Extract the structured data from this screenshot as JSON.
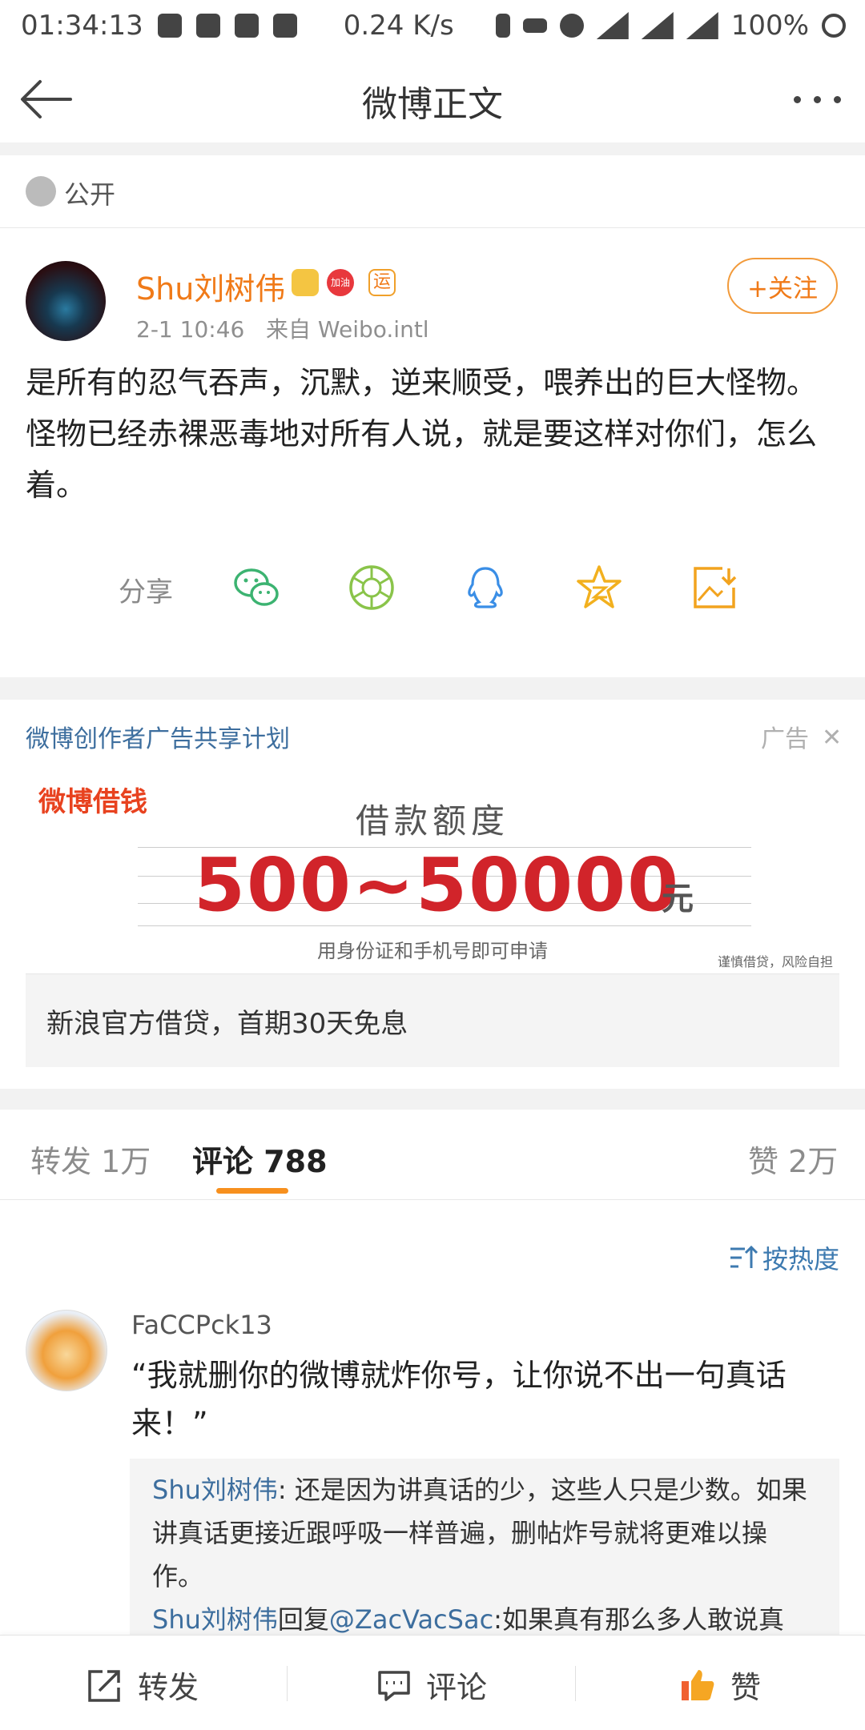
{
  "status": {
    "time": "01:34:13",
    "speed": "0.24 K/s",
    "battery": "100%"
  },
  "header": {
    "title": "微博正文"
  },
  "visibility": "公开",
  "post": {
    "author": "Shu刘树伟",
    "badge_text": "加油",
    "badge_text2": "运",
    "time": "2-1 10:46",
    "source": "来自 Weibo.intl",
    "follow_label": "+关注",
    "content": "是所有的忍气吞声，沉默，逆来顺受，喂养出的巨大怪物。怪物已经赤裸恶毒地对所有人说，就是要这样对你们，怎么着。"
  },
  "share": {
    "label": "分享",
    "icons": [
      "wechat-icon",
      "moments-icon",
      "qq-icon",
      "qzone-icon",
      "save-image-icon"
    ]
  },
  "ad": {
    "title": "微博创作者广告共享计划",
    "tag": "广告",
    "logo": "微博借钱",
    "heading": "借款额度",
    "amount": "500~50000",
    "unit": "元",
    "sub": "用身份证和手机号即可申请",
    "warning": "谨慎借贷，风险自担",
    "caption": "新浪官方借贷，首期30天免息"
  },
  "tabs": {
    "repost": "转发 1万",
    "comment": "评论 788",
    "like": "赞 2万"
  },
  "sort_label": "按热度",
  "comment": {
    "user": "FaCCPck13",
    "text": "“我就删你的微博就炸你号，让你说不出一句真话来！”",
    "reply1_user": "Shu刘树伟",
    "reply1_text": ": 还是因为讲真话的少，这些人只是少数。如果讲真话更接近跟呼吸一样普遍，删帖炸号就将更难以操作。",
    "reply2_user": "Shu刘树伟",
    "reply2_mid": "回复",
    "reply2_at": "@ZacVacSac",
    "reply2_text": ":如果真有那么多人敢说真"
  },
  "bottom": {
    "repost": "转发",
    "comment": "评论",
    "like": "赞"
  },
  "colors": {
    "orange": "#f07a18",
    "link_blue": "#3d6e9e",
    "ad_red": "#d1242a"
  }
}
